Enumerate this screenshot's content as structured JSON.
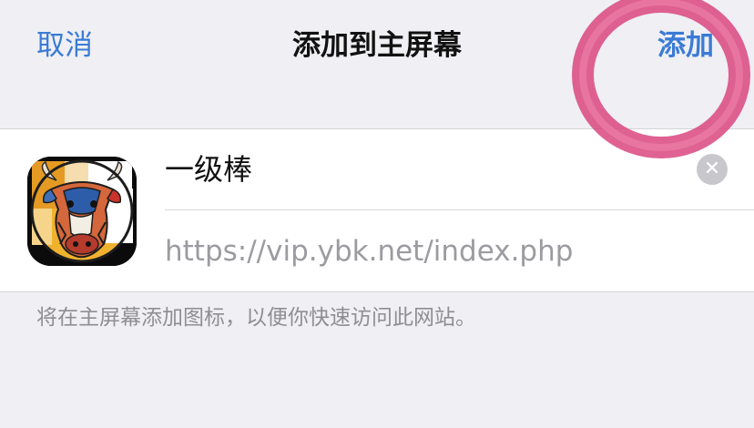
{
  "nav": {
    "cancel_label": "取消",
    "title": "添加到主屏幕",
    "add_label": "添加"
  },
  "shortcut": {
    "name": "一级棒",
    "url": "https://vip.ybk.net/index.php",
    "clear_icon": "✕"
  },
  "footer": {
    "hint": "将在主屏幕添加图标，以便你快速访问此网站。"
  },
  "colors": {
    "accent": "#3a7bd5",
    "annotation": "#d9467f"
  }
}
